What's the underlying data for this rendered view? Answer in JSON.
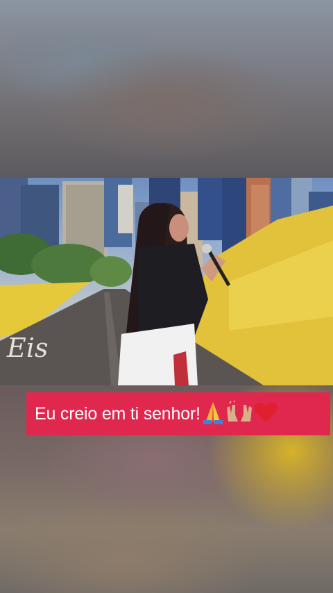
{
  "caption": {
    "text": "Eu creio em ti senhor!",
    "emojis": [
      "praying-hands-icon",
      "raised-hands-icon",
      "red-heart-icon"
    ],
    "background_color": "#e0284f",
    "text_color": "#ffffff"
  },
  "video": {
    "overlay_text": "Eis"
  }
}
